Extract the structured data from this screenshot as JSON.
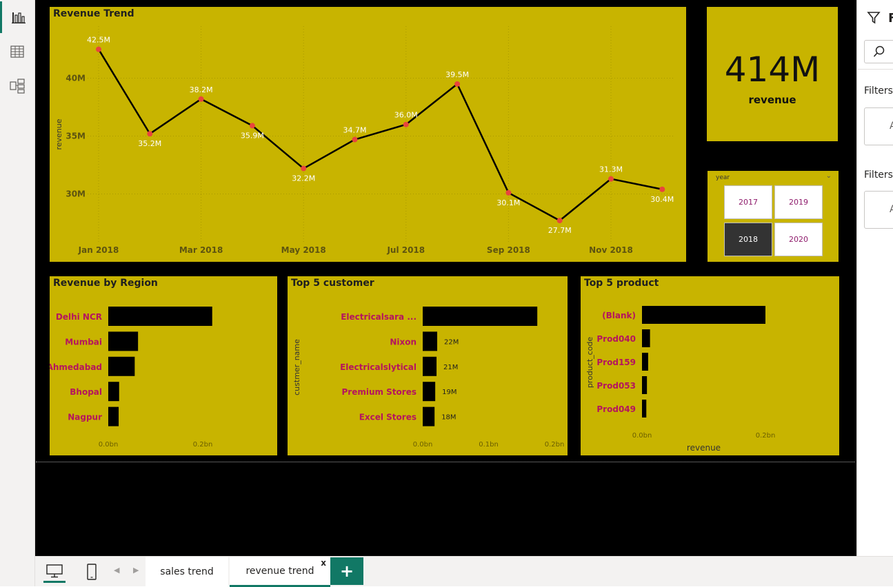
{
  "nav": {
    "items": [
      "report-view",
      "data-view",
      "model-view"
    ]
  },
  "revenue_trend": {
    "title": "Revenue Trend",
    "chart_data": {
      "type": "line",
      "x": [
        "Jan 2018",
        "Feb 2018",
        "Mar 2018",
        "Apr 2018",
        "May 2018",
        "Jun 2018",
        "Jul 2018",
        "Aug 2018",
        "Sep 2018",
        "Oct 2018",
        "Nov 2018",
        "Dec 2018"
      ],
      "values": [
        42.5,
        35.2,
        38.2,
        35.9,
        32.2,
        34.7,
        36.0,
        39.5,
        30.1,
        27.7,
        31.3,
        30.4
      ],
      "data_labels": [
        "42.5M",
        "35.2M",
        "38.2M",
        "35.9M",
        "32.2M",
        "34.7M",
        "36.0M",
        "39.5M",
        "30.1M",
        "27.7M",
        "31.3M",
        "30.4M"
      ],
      "x_tick_labels": [
        "Jan 2018",
        "Mar 2018",
        "May 2018",
        "Jul 2018",
        "Sep 2018",
        "Nov 2018"
      ],
      "y_ticks": [
        30,
        35,
        40
      ],
      "y_tick_labels": [
        "30M",
        "35M",
        "40M"
      ],
      "ylabel": "revenue",
      "ylim": [
        25.8,
        44.5
      ],
      "grid": true,
      "line_color": "#000000",
      "marker_color": "#e8453c"
    }
  },
  "kpi": {
    "value": "414M",
    "label": "revenue"
  },
  "slicer": {
    "title": "year",
    "options": [
      {
        "label": "2017",
        "selected": false
      },
      {
        "label": "2019",
        "selected": false
      },
      {
        "label": "2018",
        "selected": true
      },
      {
        "label": "2020",
        "selected": false
      }
    ]
  },
  "region": {
    "title": "Revenue by Region",
    "chart_data": {
      "type": "bar",
      "orientation": "horizontal",
      "categories": [
        "Delhi NCR",
        "Mumbai",
        "Ahmedabad",
        "Bhopal",
        "Nagpur"
      ],
      "values": [
        0.22,
        0.063,
        0.056,
        0.023,
        0.022
      ],
      "x_tick_labels": [
        "0.0bn",
        "0.2bn"
      ],
      "x_ticks": [
        0,
        0.2
      ],
      "xlim": [
        0,
        0.27
      ]
    }
  },
  "customer": {
    "title": "Top 5 customer",
    "chart_data": {
      "type": "bar",
      "orientation": "horizontal",
      "categories": [
        "Electricalsara ...",
        "Nixon",
        "Electricalslytical",
        "Premium Stores",
        "Excel Stores"
      ],
      "values": [
        0.174,
        0.022,
        0.021,
        0.019,
        0.018
      ],
      "data_labels": [
        "",
        "22M",
        "21M",
        "19M",
        "18M"
      ],
      "ylabel": "custmer_name",
      "x_tick_labels": [
        "0.0bn",
        "0.1bn",
        "0.2bn"
      ],
      "x_ticks": [
        0,
        0.1,
        0.2
      ],
      "xlim": [
        0,
        0.2
      ]
    }
  },
  "product": {
    "title": "Top 5 product",
    "chart_data": {
      "type": "bar",
      "orientation": "horizontal",
      "categories": [
        "(Blank)",
        "Prod040",
        "Prod159",
        "Prod053",
        "Prod049"
      ],
      "values": [
        0.2,
        0.013,
        0.01,
        0.008,
        0.007
      ],
      "ylabel": "product_code",
      "xlabel": "revenue",
      "x_tick_labels": [
        "0.0bn",
        "0.2bn"
      ],
      "x_ticks": [
        0,
        0.2
      ],
      "xlim": [
        0,
        0.2
      ]
    }
  },
  "right_pane": {
    "header": "F",
    "filters_label_1": "Filters",
    "filters_label_2": "Filters",
    "box_text": "A"
  },
  "tabs": [
    {
      "label": "sales trend",
      "active": false
    },
    {
      "label": "revenue trend",
      "active": true
    }
  ],
  "tab_close": "x",
  "add_tab": "+",
  "colors": {
    "panel_bg": "#c8b400",
    "canvas_bg": "#000000",
    "accent": "#117865",
    "category_text": "#b5145e"
  }
}
